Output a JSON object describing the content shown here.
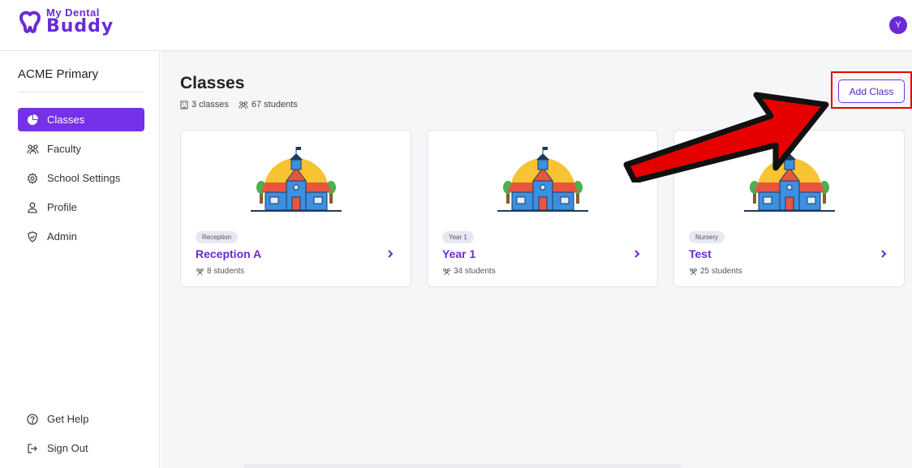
{
  "brand": {
    "line1": "My Dental",
    "line2": "Buddy",
    "color": "#6a2ad8"
  },
  "user": {
    "avatar_initial": "Y"
  },
  "sidebar": {
    "school_name": "ACME Primary",
    "items": [
      {
        "label": "Classes",
        "icon": "pie-chart-icon",
        "active": true
      },
      {
        "label": "Faculty",
        "icon": "people-icon",
        "active": false
      },
      {
        "label": "School Settings",
        "icon": "gear-icon",
        "active": false
      },
      {
        "label": "Profile",
        "icon": "user-icon",
        "active": false
      },
      {
        "label": "Admin",
        "icon": "shield-icon",
        "active": false
      }
    ],
    "footer": [
      {
        "label": "Get Help",
        "icon": "help-circle-icon"
      },
      {
        "label": "Sign Out",
        "icon": "sign-out-icon"
      }
    ]
  },
  "main": {
    "title": "Classes",
    "classes_summary": "3 classes",
    "students_summary": "67 students",
    "add_button": "Add Class"
  },
  "classes": [
    {
      "tag": "Reception",
      "name": "Reception A",
      "students": "8 students"
    },
    {
      "tag": "Year 1",
      "name": "Year 1",
      "students": "34 students"
    },
    {
      "tag": "Nursery",
      "name": "Test",
      "students": "25 students"
    }
  ],
  "colors": {
    "accent": "#7431e8",
    "annotation_red": "#e60000"
  }
}
